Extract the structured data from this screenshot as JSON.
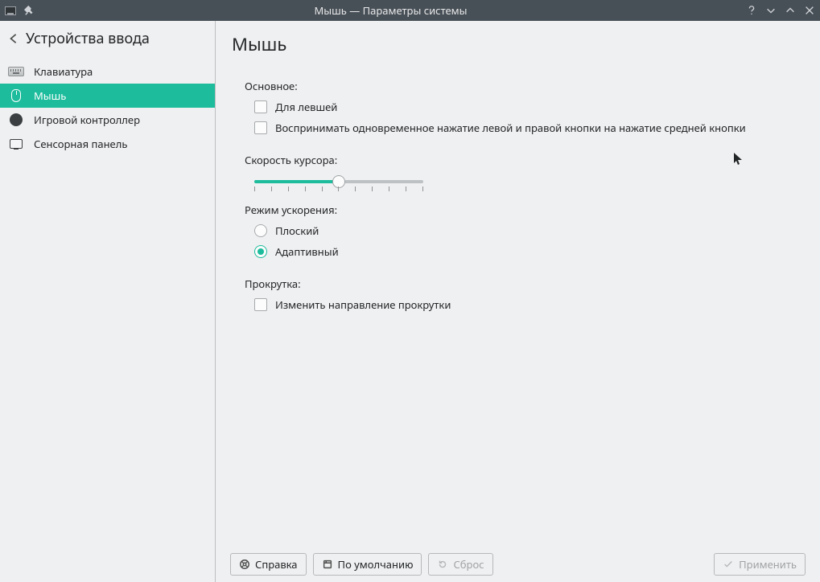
{
  "window": {
    "title": "Мышь — Параметры системы"
  },
  "sidebar": {
    "header": "Устройства ввода",
    "items": [
      {
        "label": "Клавиатура",
        "icon": "keyboard-icon",
        "selected": false
      },
      {
        "label": "Мышь",
        "icon": "mouse-icon",
        "selected": true
      },
      {
        "label": "Игровой контроллер",
        "icon": "gamepad-icon",
        "selected": false
      },
      {
        "label": "Сенсорная панель",
        "icon": "touchpad-icon",
        "selected": false
      }
    ]
  },
  "page": {
    "title": "Мышь"
  },
  "sections": {
    "general": {
      "label": "Основное:",
      "left_handed": "Для левшей",
      "middle_emulation": "Воспринимать одновременное нажатие левой и правой кнопки на нажатие средней кнопки"
    },
    "speed": {
      "label": "Скорость курсора:",
      "value_percent": 50
    },
    "accel": {
      "label": "Режим ускорения:",
      "flat": "Плоский",
      "adaptive": "Адаптивный",
      "selected": "adaptive"
    },
    "scroll": {
      "label": "Прокрутка:",
      "invert": "Изменить направление прокрутки"
    }
  },
  "footer": {
    "help": "Справка",
    "defaults": "По умолчанию",
    "reset": "Сброс",
    "apply": "Применить"
  },
  "colors": {
    "accent": "#1cbc9c"
  }
}
